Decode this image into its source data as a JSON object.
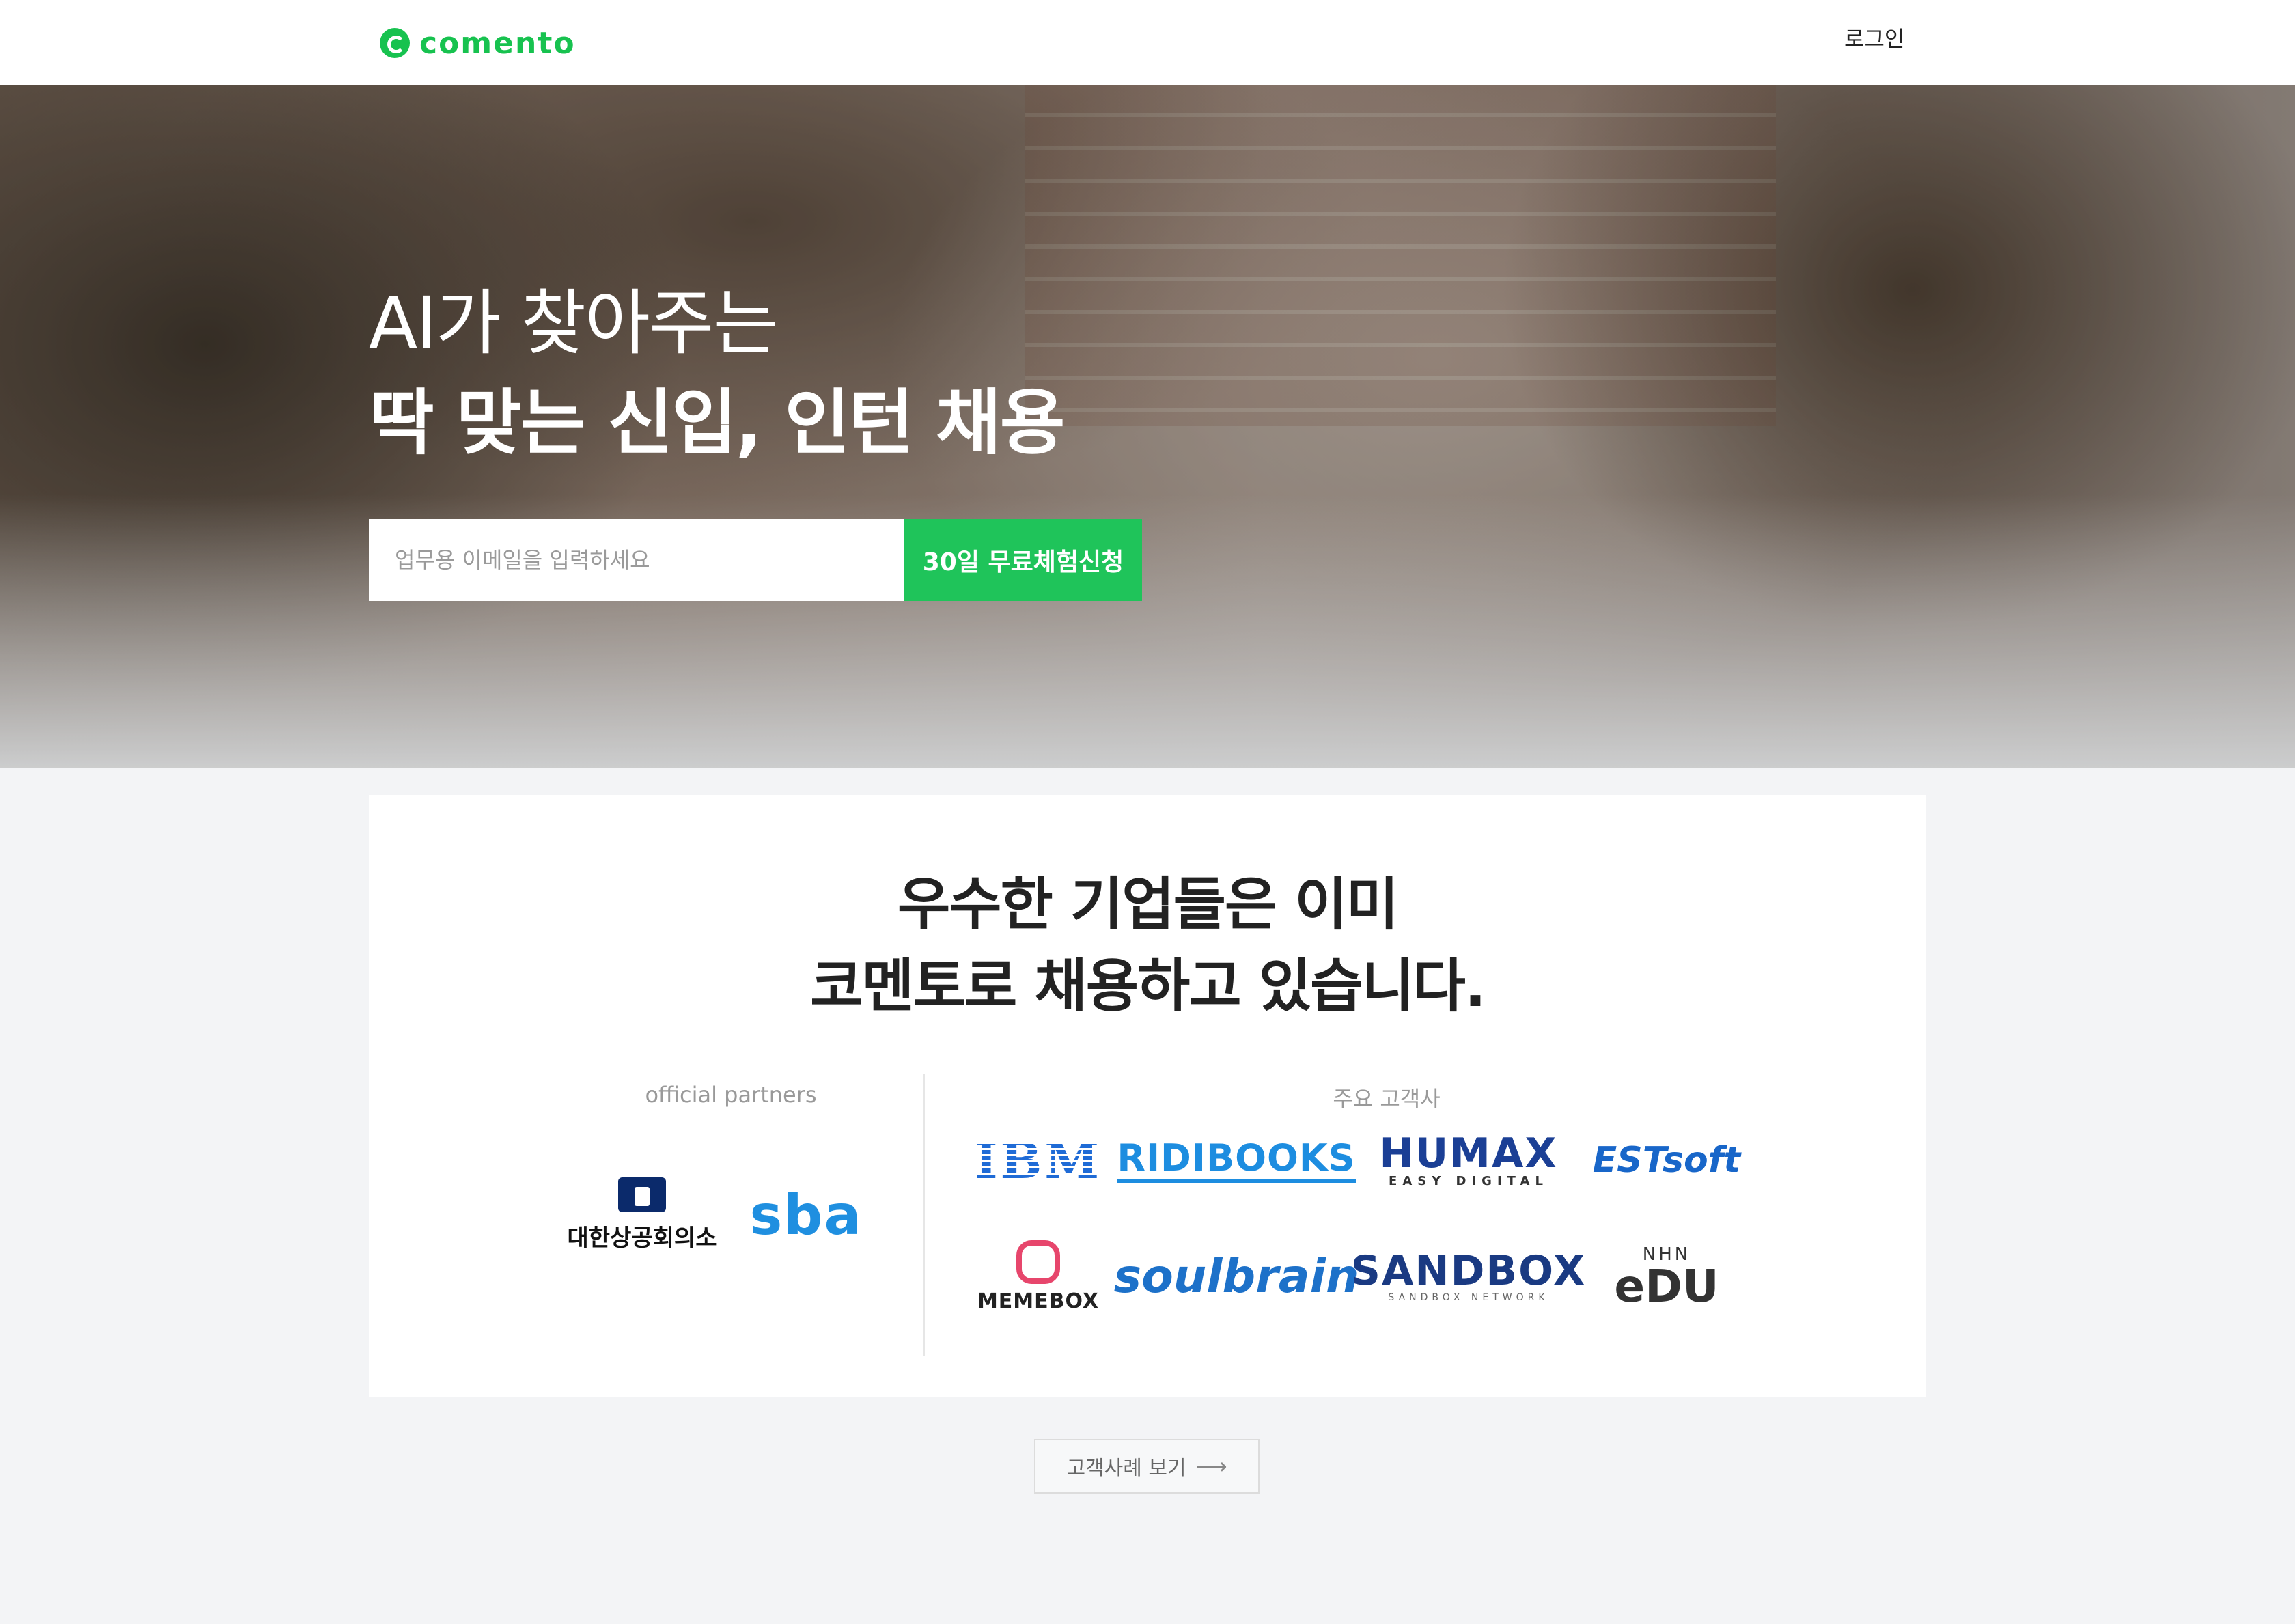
{
  "header": {
    "logo_text": "comento",
    "login_label": "로그인"
  },
  "hero": {
    "title_line1": "AI가 찾아주는",
    "title_line2": "딱 맞는 신입, 인턴 채용",
    "email_placeholder": "업무용 이메일을 입력하세요",
    "trial_button_label": "30일 무료체험신청"
  },
  "clients": {
    "heading_line1": "우수한 기업들은 이미",
    "heading_line2": "코멘토로 채용하고 있습니다.",
    "partners_label": "official partners",
    "customers_label": "주요 고객사",
    "partners": [
      "대한상공회의소",
      "sba"
    ],
    "customers": [
      "IBM",
      "RIDIBOOKS",
      "HUMAX",
      "EASY DIGITAL",
      "ESTsoft",
      "MEMEBOX",
      "soulbrain",
      "SANDBOX",
      "SANDBOX NETWORK",
      "NHN",
      "eDU"
    ]
  },
  "cases_button": {
    "label": "고객사례 보기",
    "icon": "arrow-right-icon"
  },
  "colors": {
    "brand_green": "#1fc45a",
    "background": "#f3f4f6"
  }
}
